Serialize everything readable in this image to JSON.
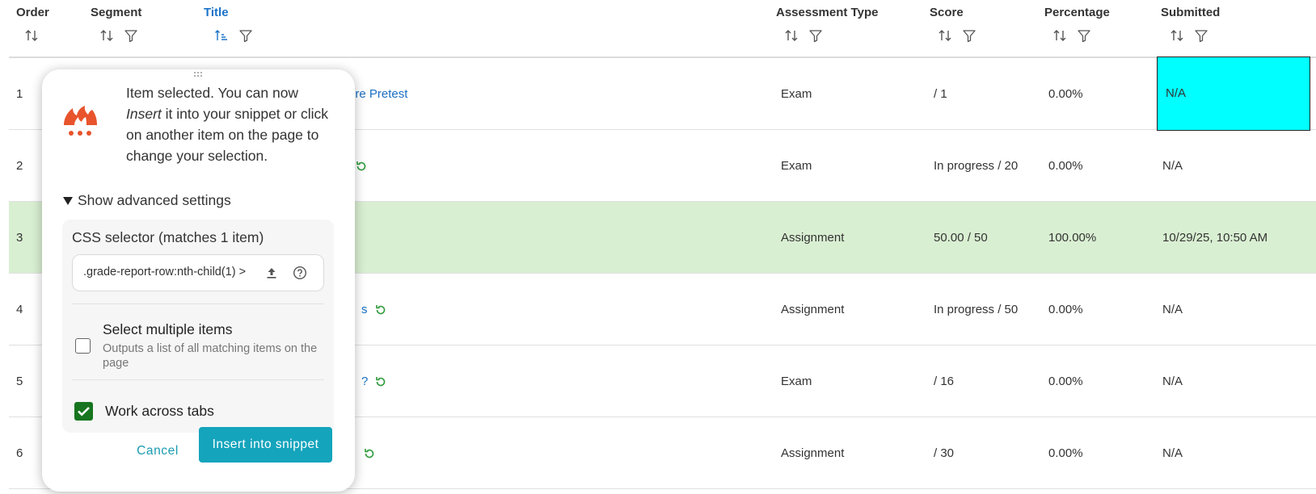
{
  "table": {
    "columns": [
      {
        "label": "Order",
        "sort_icon": "sort-arrows-icon",
        "filter": false
      },
      {
        "label": "Segment",
        "sort_icon": "sort-arrows-icon",
        "filter": true
      },
      {
        "label": "Title",
        "sort_icon": "sort-ascending-icon",
        "filter": true,
        "active": true
      },
      {
        "label": "Assessment Type",
        "sort_icon": "sort-arrows-icon",
        "filter": true
      },
      {
        "label": "Score",
        "sort_icon": "sort-arrows-icon",
        "filter": true
      },
      {
        "label": "Percentage",
        "sort_icon": "sort-arrows-icon",
        "filter": true
      },
      {
        "label": "Submitted",
        "sort_icon": "sort-arrows-icon",
        "filter": true
      }
    ],
    "rows": [
      {
        "order": "1",
        "title": "ure Pretest",
        "title_refresh": false,
        "type": "Exam",
        "score": "/ 1",
        "percentage": "0.00%",
        "submitted": "N/A"
      },
      {
        "order": "2",
        "title": "",
        "title_refresh": true,
        "type": "Exam",
        "score": "In progress / 20",
        "percentage": "0.00%",
        "submitted": "N/A"
      },
      {
        "order": "3",
        "title": "",
        "title_refresh": false,
        "type": "Assignment",
        "score": "50.00 / 50",
        "percentage": "100.00%",
        "submitted": "10/29/25, 10:50 AM",
        "highlighted": true
      },
      {
        "order": "4",
        "title": "s",
        "title_refresh": true,
        "type": "Assignment",
        "score": "In progress / 50",
        "percentage": "0.00%",
        "submitted": "N/A"
      },
      {
        "order": "5",
        "title": "?",
        "title_refresh": true,
        "type": "Exam",
        "score": "/ 16",
        "percentage": "0.00%",
        "submitted": "N/A"
      },
      {
        "order": "6",
        "title": "",
        "title_refresh": true,
        "type": "Assignment",
        "score": "/ 30",
        "percentage": "0.00%",
        "submitted": "N/A"
      }
    ],
    "colors": {
      "row_highlight": "#d9efd2",
      "title_link": "#1a6fc2",
      "selection_box": "#00ffff",
      "refresh_icon": "#2e9a3a"
    }
  },
  "popup": {
    "logo_icon": "flame-logo-icon",
    "message_pre": "Item selected. You can now ",
    "message_em": "Insert",
    "message_post": " it into your snippet or click on another item on the page to change your selection.",
    "advanced_toggle": "Show advanced settings",
    "css_selector_label": "CSS selector (matches 1 item)",
    "css_selector_value": ".grade-report-row:nth-child(1) >",
    "select_multiple_label": "Select multiple items",
    "select_multiple_checked": false,
    "select_multiple_desc": "Outputs a list of all matching items on the page",
    "work_across_tabs_label": "Work across tabs",
    "work_across_tabs_checked": true,
    "cancel_label": "Cancel",
    "insert_label": "Insert into snippet",
    "colors": {
      "accent": "#14a4bc",
      "checkbox": "#17751f",
      "logo": "#e8542c"
    }
  }
}
